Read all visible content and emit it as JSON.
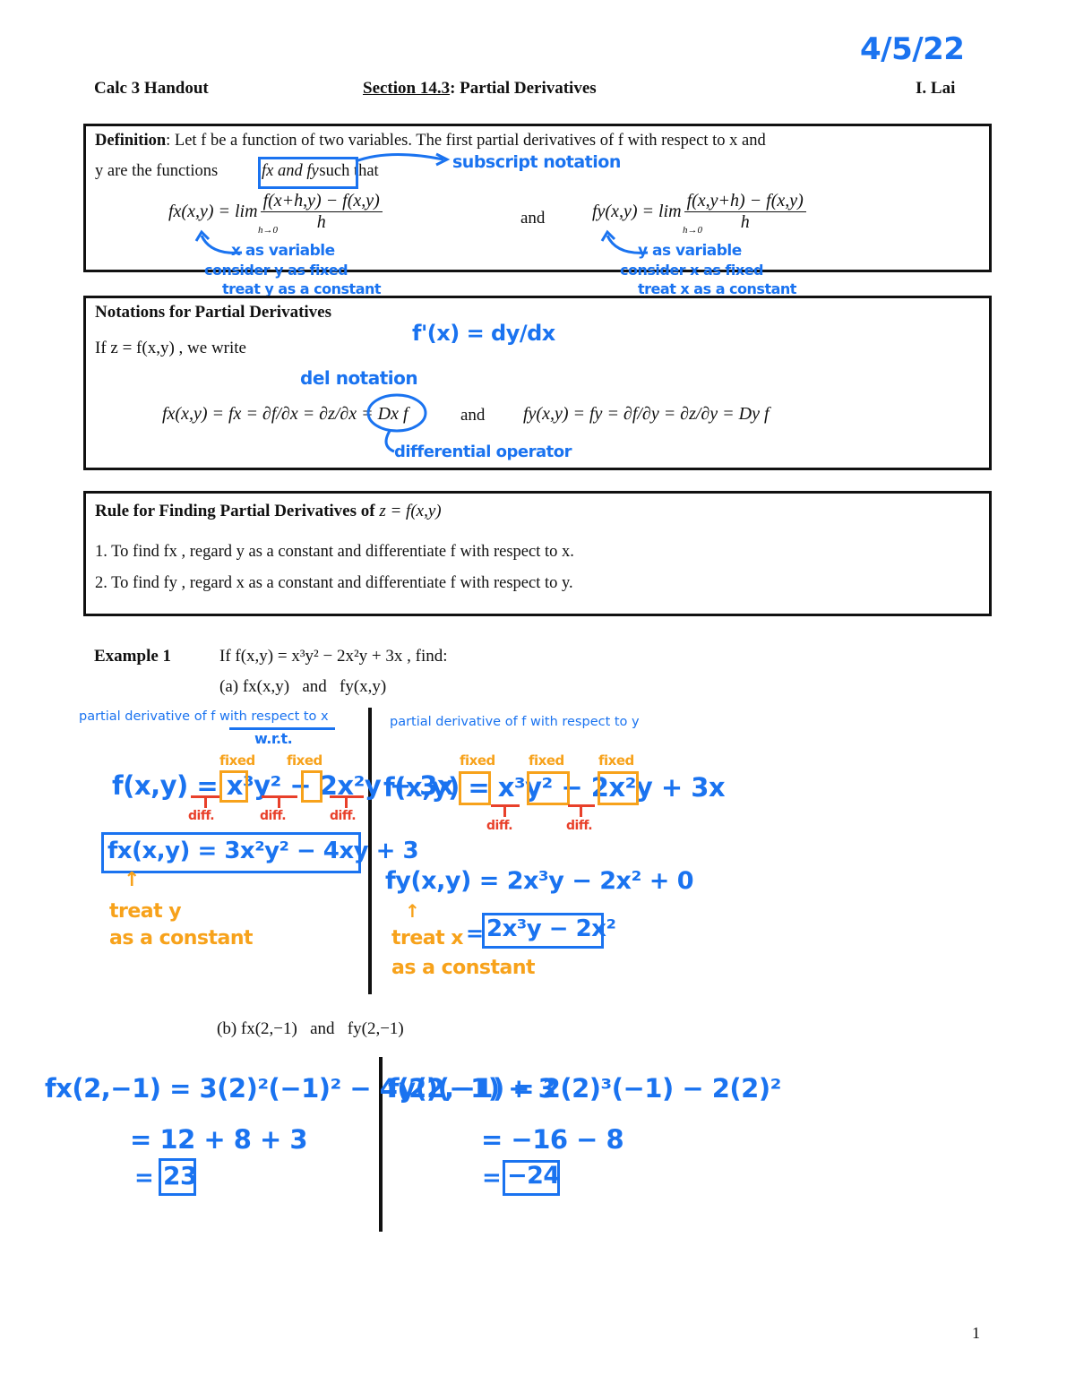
{
  "header": {
    "date_annotation": "4/5/22",
    "left": "Calc 3 Handout",
    "section_label": "Section 14.3",
    "section_title": ": Partial Derivatives",
    "author": "I. Lai"
  },
  "definition": {
    "label": "Definition",
    "text_1": ": Let f be a function of two variables. The first partial derivatives of f with respect to x and",
    "text_2a": "y are the functions",
    "boxed": "fx and fy",
    "text_2b": "such that",
    "formula_x_lhs": "fx(x,y) = lim",
    "formula_x_num": "f(x+h,y) − f(x,y)",
    "formula_den": "h",
    "lim_under": "h→0",
    "and": "and",
    "formula_y_lhs": "fy(x,y) = lim",
    "formula_y_num": "f(x,y+h) − f(x,y)",
    "annotations": {
      "subscript": "subscript notation",
      "x_var": [
        "x as variable",
        "consider y as fixed",
        "treat y as a constant"
      ],
      "y_var": [
        "y as variable",
        "consider x as fixed",
        "treat x as a constant"
      ]
    }
  },
  "notations": {
    "title": "Notations for Partial Derivatives",
    "intro": "If z = f(x,y) , we write",
    "fx_chain": "fx(x,y) = fx = ∂f/∂x = ∂z/∂x = Dx f",
    "and": "and",
    "fy_chain": "fy(x,y) = fy = ∂f/∂y = ∂z/∂y = Dy f",
    "annotations": {
      "fprime": "f'(x) = dy/dx",
      "del": "del notation",
      "operator": "differential operator"
    }
  },
  "rule": {
    "title": "Rule for Finding Partial Derivatives of",
    "title_math": "z = f(x,y)",
    "items": [
      "1. To find fx , regard y as a constant and differentiate f with respect to x.",
      "2. To find fy , regard x as a constant and differentiate f with respect to y."
    ]
  },
  "example": {
    "label": "Example 1",
    "prompt": "If f(x,y) = x³y² − 2x²y + 3x , find:",
    "part_a": "(a) fx(x,y)   and   fy(x,y)",
    "part_b": "(b) fx(2,−1)   and   fy(2,−1)",
    "left_col": {
      "heading": "partial derivative of f with respect to x",
      "wrt": "w.r.t.",
      "func": "f(x,y) = x³y² − 2x²y + 3x",
      "fixed": "fixed",
      "diff": "diff.",
      "result": "fx(x,y) = 3x²y² − 4xy + 3",
      "note": [
        "treat y",
        "as a constant"
      ]
    },
    "right_col": {
      "heading": "partial derivative of f with respect to y",
      "func": "f(x,y) = x³y² − 2x²y + 3x",
      "fixed": "fixed",
      "diff": "diff.",
      "line1": "fy(x,y) = 2x³y − 2x² + 0",
      "line2_eq": "=",
      "line2_boxed": "2x³y − 2x²",
      "note": [
        "treat x",
        "as a constant"
      ]
    },
    "eval_left": {
      "line1": "fx(2,−1) = 3(2)²(−1)² − 4(2)(−1) + 3",
      "line2": "= 12 + 8 + 3",
      "line3_eq": "=",
      "answer": "23"
    },
    "eval_right": {
      "line1": "fy(2,−1) = 2(2)³(−1) − 2(2)²",
      "line2": "= −16 − 8",
      "line3_eq": "=",
      "answer": "−24"
    }
  },
  "page_number": "1"
}
